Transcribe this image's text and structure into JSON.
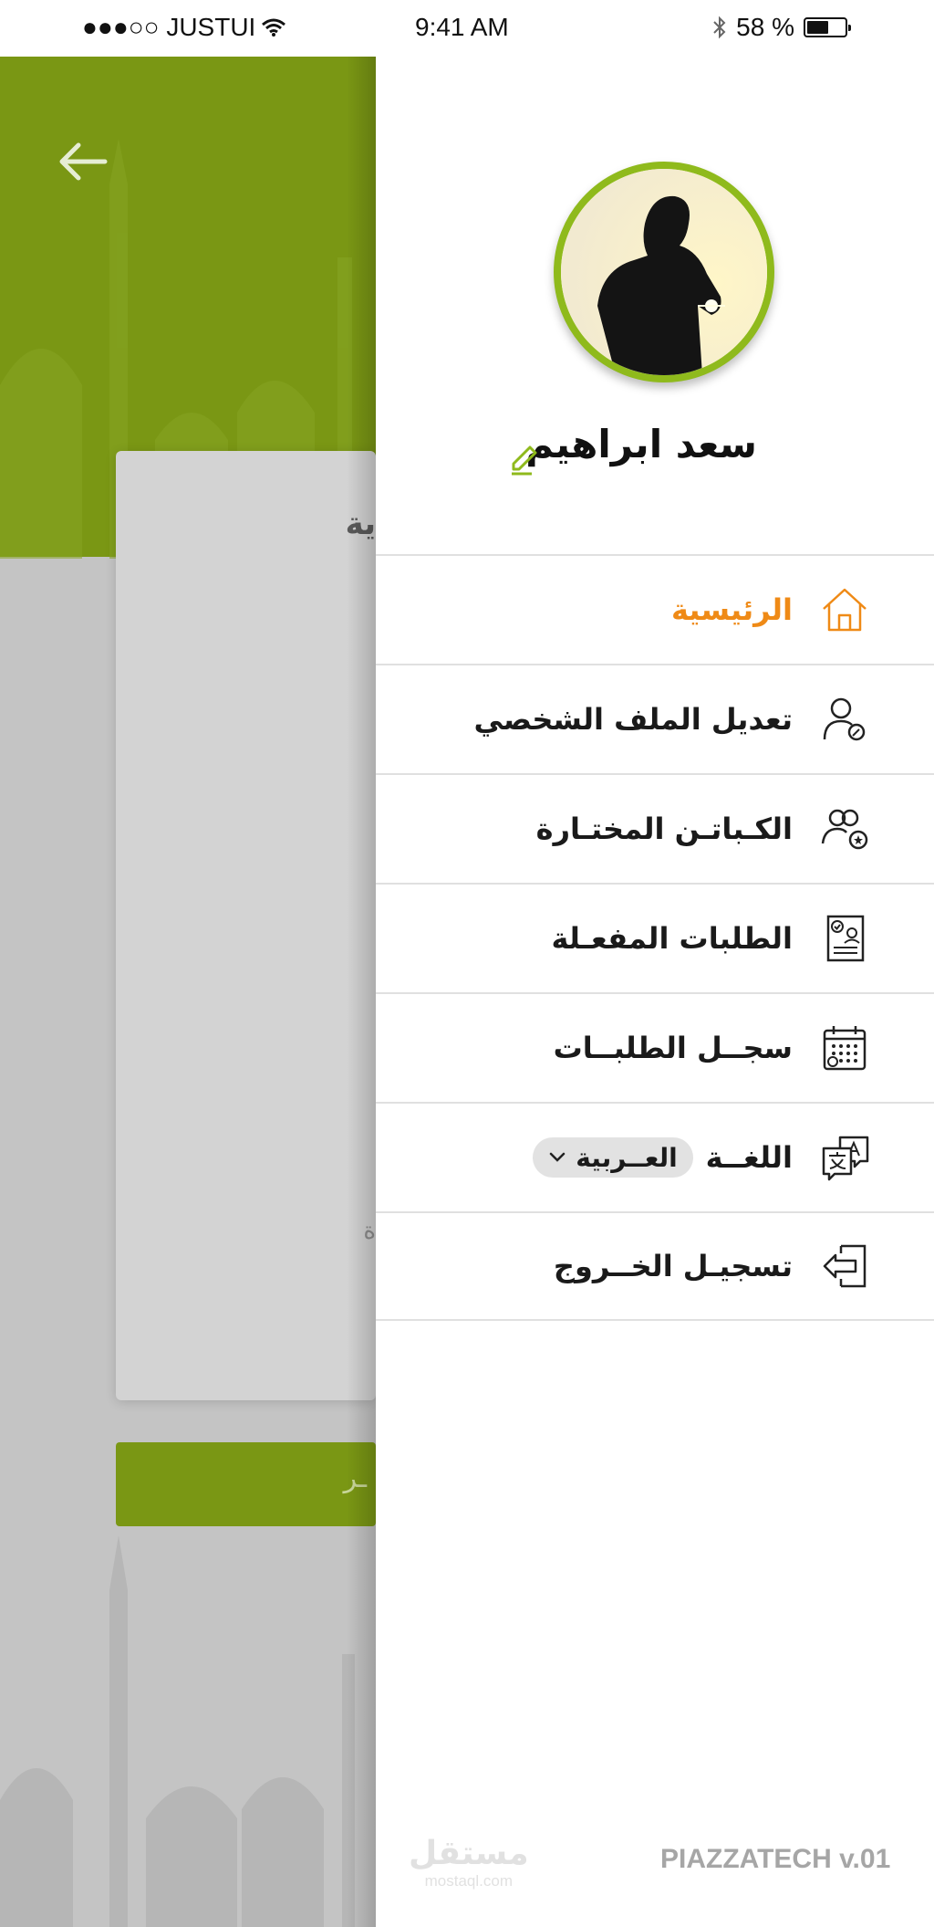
{
  "status_bar": {
    "carrier": "●●●○○ JUSTUI",
    "time": "9:41 AM",
    "battery": "58 %",
    "battery_level": 0.58
  },
  "background": {
    "card_title": "ية",
    "card_sub": "ة",
    "button_label": "ـر",
    "header_color": "#7a9714"
  },
  "drawer": {
    "user_name": "سعد ابراهيم",
    "menu": [
      {
        "label": "الرئيسية",
        "icon": "home-icon",
        "active": true
      },
      {
        "label": "تعديل الملف الشخصي",
        "icon": "user-edit-icon"
      },
      {
        "label": "الكـباتـن المختـارة",
        "icon": "users-star-icon"
      },
      {
        "label": "الطلبات المفعـلة",
        "icon": "active-requests-icon"
      },
      {
        "label": "سجــل الطلبــات",
        "icon": "calendar-icon"
      },
      {
        "label": "اللغــة",
        "icon": "translate-icon",
        "language_value": "العــربية"
      },
      {
        "label": "تسجيـل الخــروج",
        "icon": "logout-icon"
      }
    ],
    "version": "PIAZZATECH v.01",
    "watermark_main": "مستقل",
    "watermark_sub": "mostaql.com"
  },
  "colors": {
    "accent_green": "#8fba1c",
    "active_orange": "#ef8a16"
  }
}
